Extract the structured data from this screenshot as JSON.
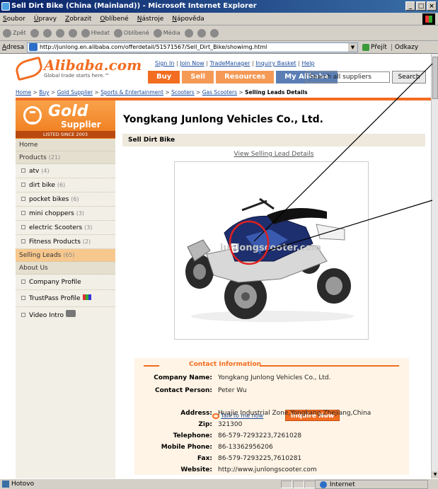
{
  "window": {
    "title": "Sell Dirt Bike (China (Mainland)) - Microsoft Internet Explorer",
    "controls": [
      "_",
      "□",
      "×"
    ]
  },
  "menu": [
    "Soubor",
    "Úpravy",
    "Zobrazit",
    "Oblíbené",
    "Nástroje",
    "Nápověda"
  ],
  "toolbar": [
    "Zpět",
    "Hledat",
    "Oblíbené",
    "Média"
  ],
  "address": {
    "label": "Adresa",
    "url": "http://junlong.en.alibaba.com/offerdetail/51571567/Sell_Dirt_Bike/showimg.html",
    "go_label": "Přejít",
    "links_label": "Odkazy"
  },
  "alibaba": {
    "brand": "Alibaba.com",
    "tagline": "Global trade starts here.™",
    "sign_in": "Sign In",
    "join_now": "Join Now",
    "trade_manager": "TradeManager",
    "inquiry_basket": "Inquiry Basket",
    "help": "Help",
    "nav": [
      "Buy",
      "Sell",
      "Resources",
      "My Alibaba"
    ],
    "search_value": "Search all suppliers",
    "search_btn": "Search"
  },
  "breadcrumb": [
    "Home",
    "Buy",
    "Gold Supplier",
    "Sports & Entertainment",
    "Scooters",
    "Gas Scooters",
    "Selling Leads Details"
  ],
  "gold": {
    "word": "Gold",
    "supplier": "Supplier",
    "listed": "LISTED SINCE 2003"
  },
  "leftnav": {
    "home": "Home",
    "products": "Products",
    "products_count": "(21)",
    "items": [
      {
        "label": "atv",
        "count": "(4)"
      },
      {
        "label": "dirt bike",
        "count": "(6)"
      },
      {
        "label": "pocket bikes",
        "count": "(6)"
      },
      {
        "label": "mini choppers",
        "count": "(3)"
      },
      {
        "label": "electric Scooters",
        "count": "(3)"
      },
      {
        "label": "Fitness Products",
        "count": "(2)"
      }
    ],
    "selling_leads": "Selling Leads",
    "selling_leads_count": "(65)",
    "about_us": "About Us",
    "about_items": [
      "Company Profile",
      "TrustPass Profile",
      "Video Intro"
    ]
  },
  "main": {
    "company": "Yongkang Junlong Vehicles Co., Ltd.",
    "lead_title": "Sell Dirt Bike",
    "view_lead": "View Selling Lead Details",
    "watermark": "junlongscooter.com"
  },
  "contact": {
    "title": "Contact Information",
    "talk_link": "Talk to me now",
    "inquire_btn": "Inquire Now",
    "rows": [
      {
        "label": "Company Name:",
        "value": "Yongkang Junlong Vehicles Co., Ltd."
      },
      {
        "label": "Contact Person:",
        "value": "Peter Wu"
      },
      {
        "label": "Address:",
        "value": "Huajie Industrial Zone,Yongkang,Zhejiang,China"
      },
      {
        "label": "Zip:",
        "value": "321300"
      },
      {
        "label": "Telephone:",
        "value": "86-579-7293223,7261028"
      },
      {
        "label": "Mobile Phone:",
        "value": "86-13362956206"
      },
      {
        "label": "Fax:",
        "value": "86-579-7293225,7610281"
      },
      {
        "label": "Website:",
        "value": "http://www.junlongscooter.com"
      }
    ]
  },
  "status": {
    "left": "Hotovo",
    "zone": "Internet"
  },
  "colors": {
    "alibaba_orange": "#f26d21",
    "annotation_red": "#e02020"
  }
}
